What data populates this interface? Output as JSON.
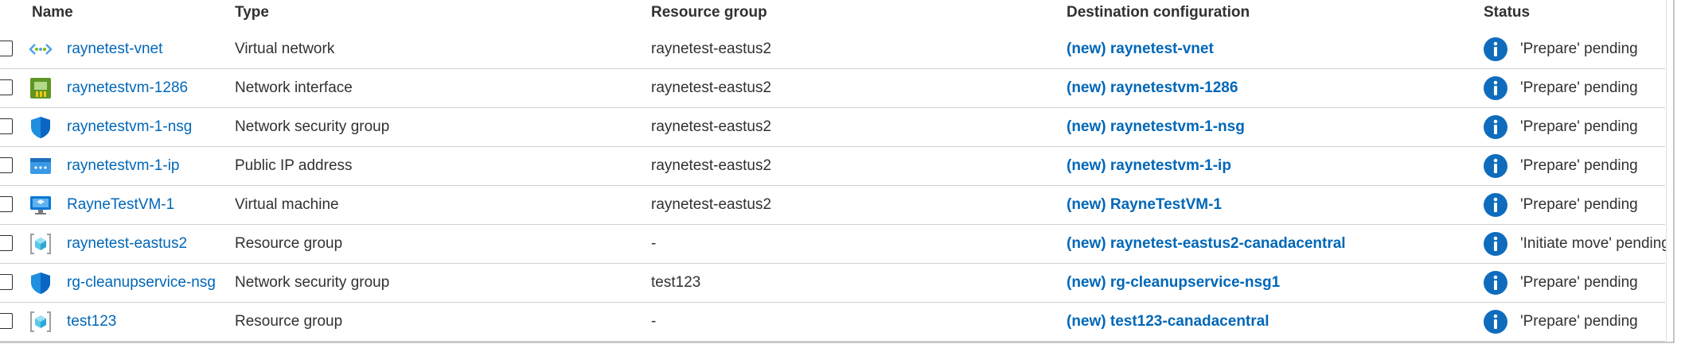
{
  "columns": {
    "name": "Name",
    "type": "Type",
    "resource_group": "Resource group",
    "destination": "Destination configuration",
    "status": "Status"
  },
  "rows": [
    {
      "name": "raynetest-vnet",
      "type": "Virtual network",
      "resource_group": "raynetest-eastus2",
      "destination": "(new) raynetest-vnet",
      "status": "'Prepare' pending",
      "icon": "virtual-network-icon"
    },
    {
      "name": "raynetestvm-1286",
      "type": "Network interface",
      "resource_group": "raynetest-eastus2",
      "destination": "(new) raynetestvm-1286",
      "status": "'Prepare' pending",
      "icon": "network-interface-icon"
    },
    {
      "name": "raynetestvm-1-nsg",
      "type": "Network security group",
      "resource_group": "raynetest-eastus2",
      "destination": "(new) raynetestvm-1-nsg",
      "status": "'Prepare' pending",
      "icon": "network-security-group-icon"
    },
    {
      "name": "raynetestvm-1-ip",
      "type": "Public IP address",
      "resource_group": "raynetest-eastus2",
      "destination": "(new) raynetestvm-1-ip",
      "status": "'Prepare' pending",
      "icon": "public-ip-icon"
    },
    {
      "name": "RayneTestVM-1",
      "type": "Virtual machine",
      "resource_group": "raynetest-eastus2",
      "destination": "(new) RayneTestVM-1",
      "status": "'Prepare' pending",
      "icon": "virtual-machine-icon"
    },
    {
      "name": "raynetest-eastus2",
      "type": "Resource group",
      "resource_group": "-",
      "destination": "(new) raynetest-eastus2-canadacentral",
      "status": "'Initiate move' pending",
      "icon": "resource-group-icon"
    },
    {
      "name": "rg-cleanupservice-nsg",
      "type": "Network security group",
      "resource_group": "test123",
      "destination": "(new) rg-cleanupservice-nsg1",
      "status": "'Prepare' pending",
      "icon": "network-security-group-icon"
    },
    {
      "name": "test123",
      "type": "Resource group",
      "resource_group": "-",
      "destination": "(new) test123-canadacentral",
      "status": "'Prepare' pending",
      "icon": "resource-group-icon"
    }
  ],
  "colors": {
    "link": "#0067b8",
    "text": "#323130",
    "info_icon": "#0f6cbd",
    "row_divider": "#d2d0ce"
  },
  "status_icon": "info-icon"
}
